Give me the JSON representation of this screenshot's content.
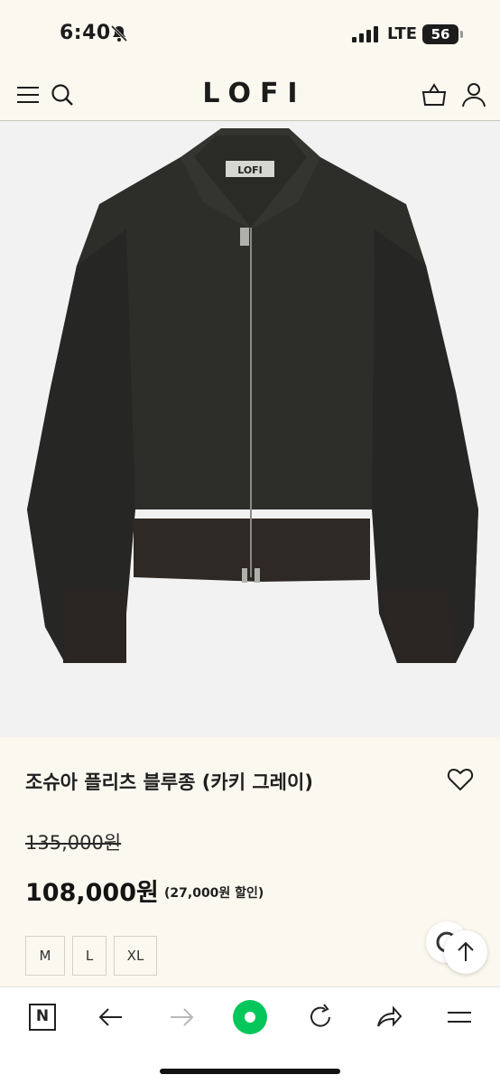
{
  "status_bar": {
    "time": "6:40",
    "network": "LTE",
    "battery": "56"
  },
  "header": {
    "logo": "LOFI",
    "garment_label": "LOFI"
  },
  "product": {
    "title": "조슈아 플리츠 블루종 (카키 그레이)",
    "original_price": "135,000원",
    "sale_price": "108,000원",
    "discount_note": "(27,000원 할인)",
    "sizes": [
      "M",
      "L",
      "XL"
    ]
  },
  "toolbar": {
    "naver_label": "N"
  },
  "colors": {
    "background": "#fbf8ef",
    "accent_green": "#03c75a",
    "jacket": "#2a2a27"
  }
}
